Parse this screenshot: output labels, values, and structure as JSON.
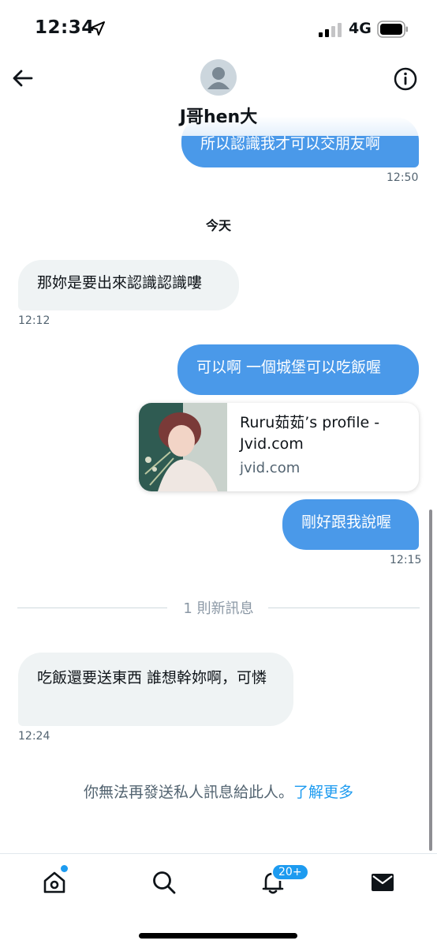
{
  "status_bar": {
    "time": "12:34",
    "network": "4G",
    "location_icon": "location-arrow-icon",
    "signal_icon": "signal-bars-icon",
    "battery_icon": "battery-icon"
  },
  "header": {
    "contact_name": "J哥hen大",
    "back_icon": "back-arrow-icon",
    "info_icon": "info-icon",
    "avatar_icon": "default-avatar-icon"
  },
  "messages": [
    {
      "type": "sent",
      "text": "所以認識我才可以交朋友啊",
      "time": "12:50"
    },
    {
      "type": "day",
      "text": "今天"
    },
    {
      "type": "received",
      "text": "那妳是要出來認識認識嘍",
      "time": "12:12"
    },
    {
      "type": "sent",
      "text": "可以啊 一個城堡可以吃飯喔"
    },
    {
      "type": "link",
      "title": "Ruru茹茹’s profile - Jvid.com",
      "domain": "jvid.com"
    },
    {
      "type": "sent",
      "text": "剛好跟我說喔",
      "time": "12:15"
    },
    {
      "type": "received",
      "text": "吃飯還要送東西 誰想幹妳啊，可憐",
      "time": "12:24"
    }
  ],
  "new_messages_divider": "1 則新訊息",
  "notice": {
    "text": "你無法再發送私人訊息給此人。",
    "link": "了解更多"
  },
  "bottom_nav": {
    "items": [
      {
        "icon": "home-icon"
      },
      {
        "icon": "search-icon"
      },
      {
        "icon": "notifications-bell-icon",
        "badge": "20+"
      },
      {
        "icon": "messages-envelope-icon"
      }
    ]
  },
  "colors": {
    "sent_bubble": "#4a99e9",
    "received_bubble": "#eff3f4",
    "accent": "#1d9bf0"
  }
}
